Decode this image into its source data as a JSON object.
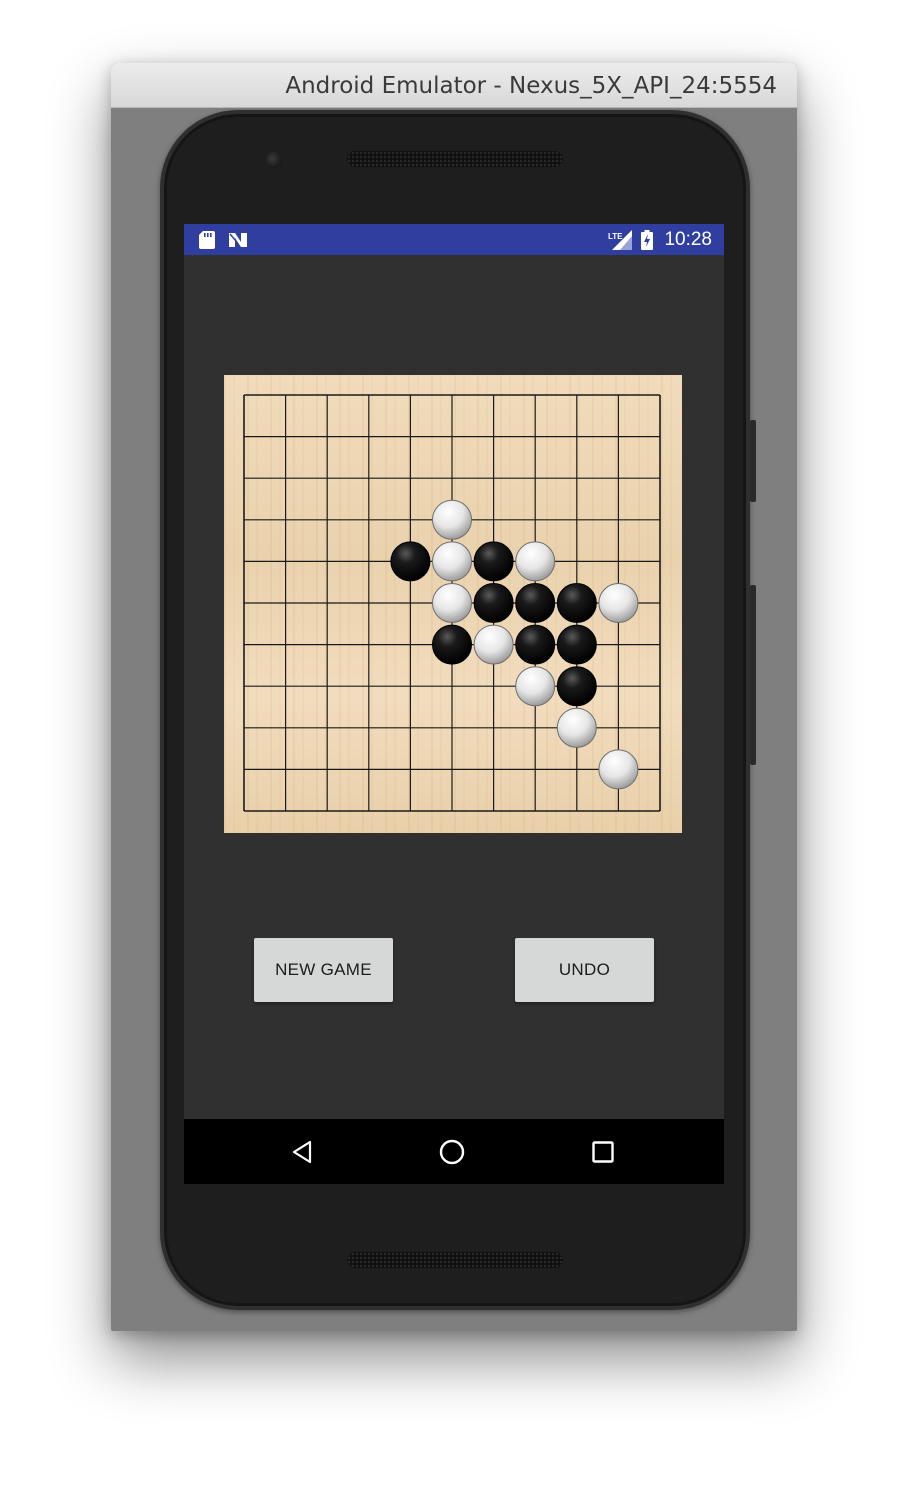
{
  "window": {
    "title": "Android Emulator - Nexus_5X_API_24:5554"
  },
  "statusbar": {
    "time": "10:28",
    "left_icons": [
      "sd-card-icon",
      "nougat-n-icon"
    ],
    "right_icons": [
      "lte-signal-icon",
      "battery-charging-icon"
    ],
    "color": "#303f9f"
  },
  "board": {
    "size": 11,
    "empty_cells_marker": ".",
    "rows": [
      "...........",
      "...........",
      "...........",
      ".....W.....",
      "....BWBW...",
      ".....WBBBW.",
      ".....BWBB..",
      ".......WB..",
      "........W..",
      ".........W.",
      "..........."
    ],
    "colors": {
      "wood": "#ecd5b1",
      "line": "#1a1a1a",
      "black_stone": "#111111",
      "white_stone": "#f4f4f4"
    }
  },
  "buttons": {
    "new_game": "NEW GAME",
    "undo": "UNDO"
  },
  "navbar": {
    "keys": [
      "back-icon",
      "home-icon",
      "recents-icon"
    ]
  }
}
